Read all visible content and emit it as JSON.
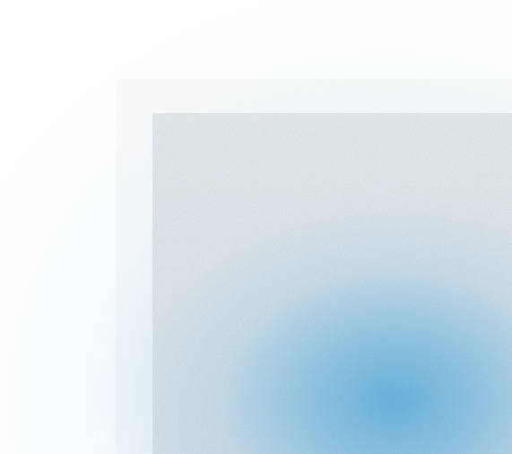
{
  "background": {
    "base_color": "#ffffff",
    "accent_color": "#6bb8e8",
    "panel_color": "#dfeaf1"
  }
}
